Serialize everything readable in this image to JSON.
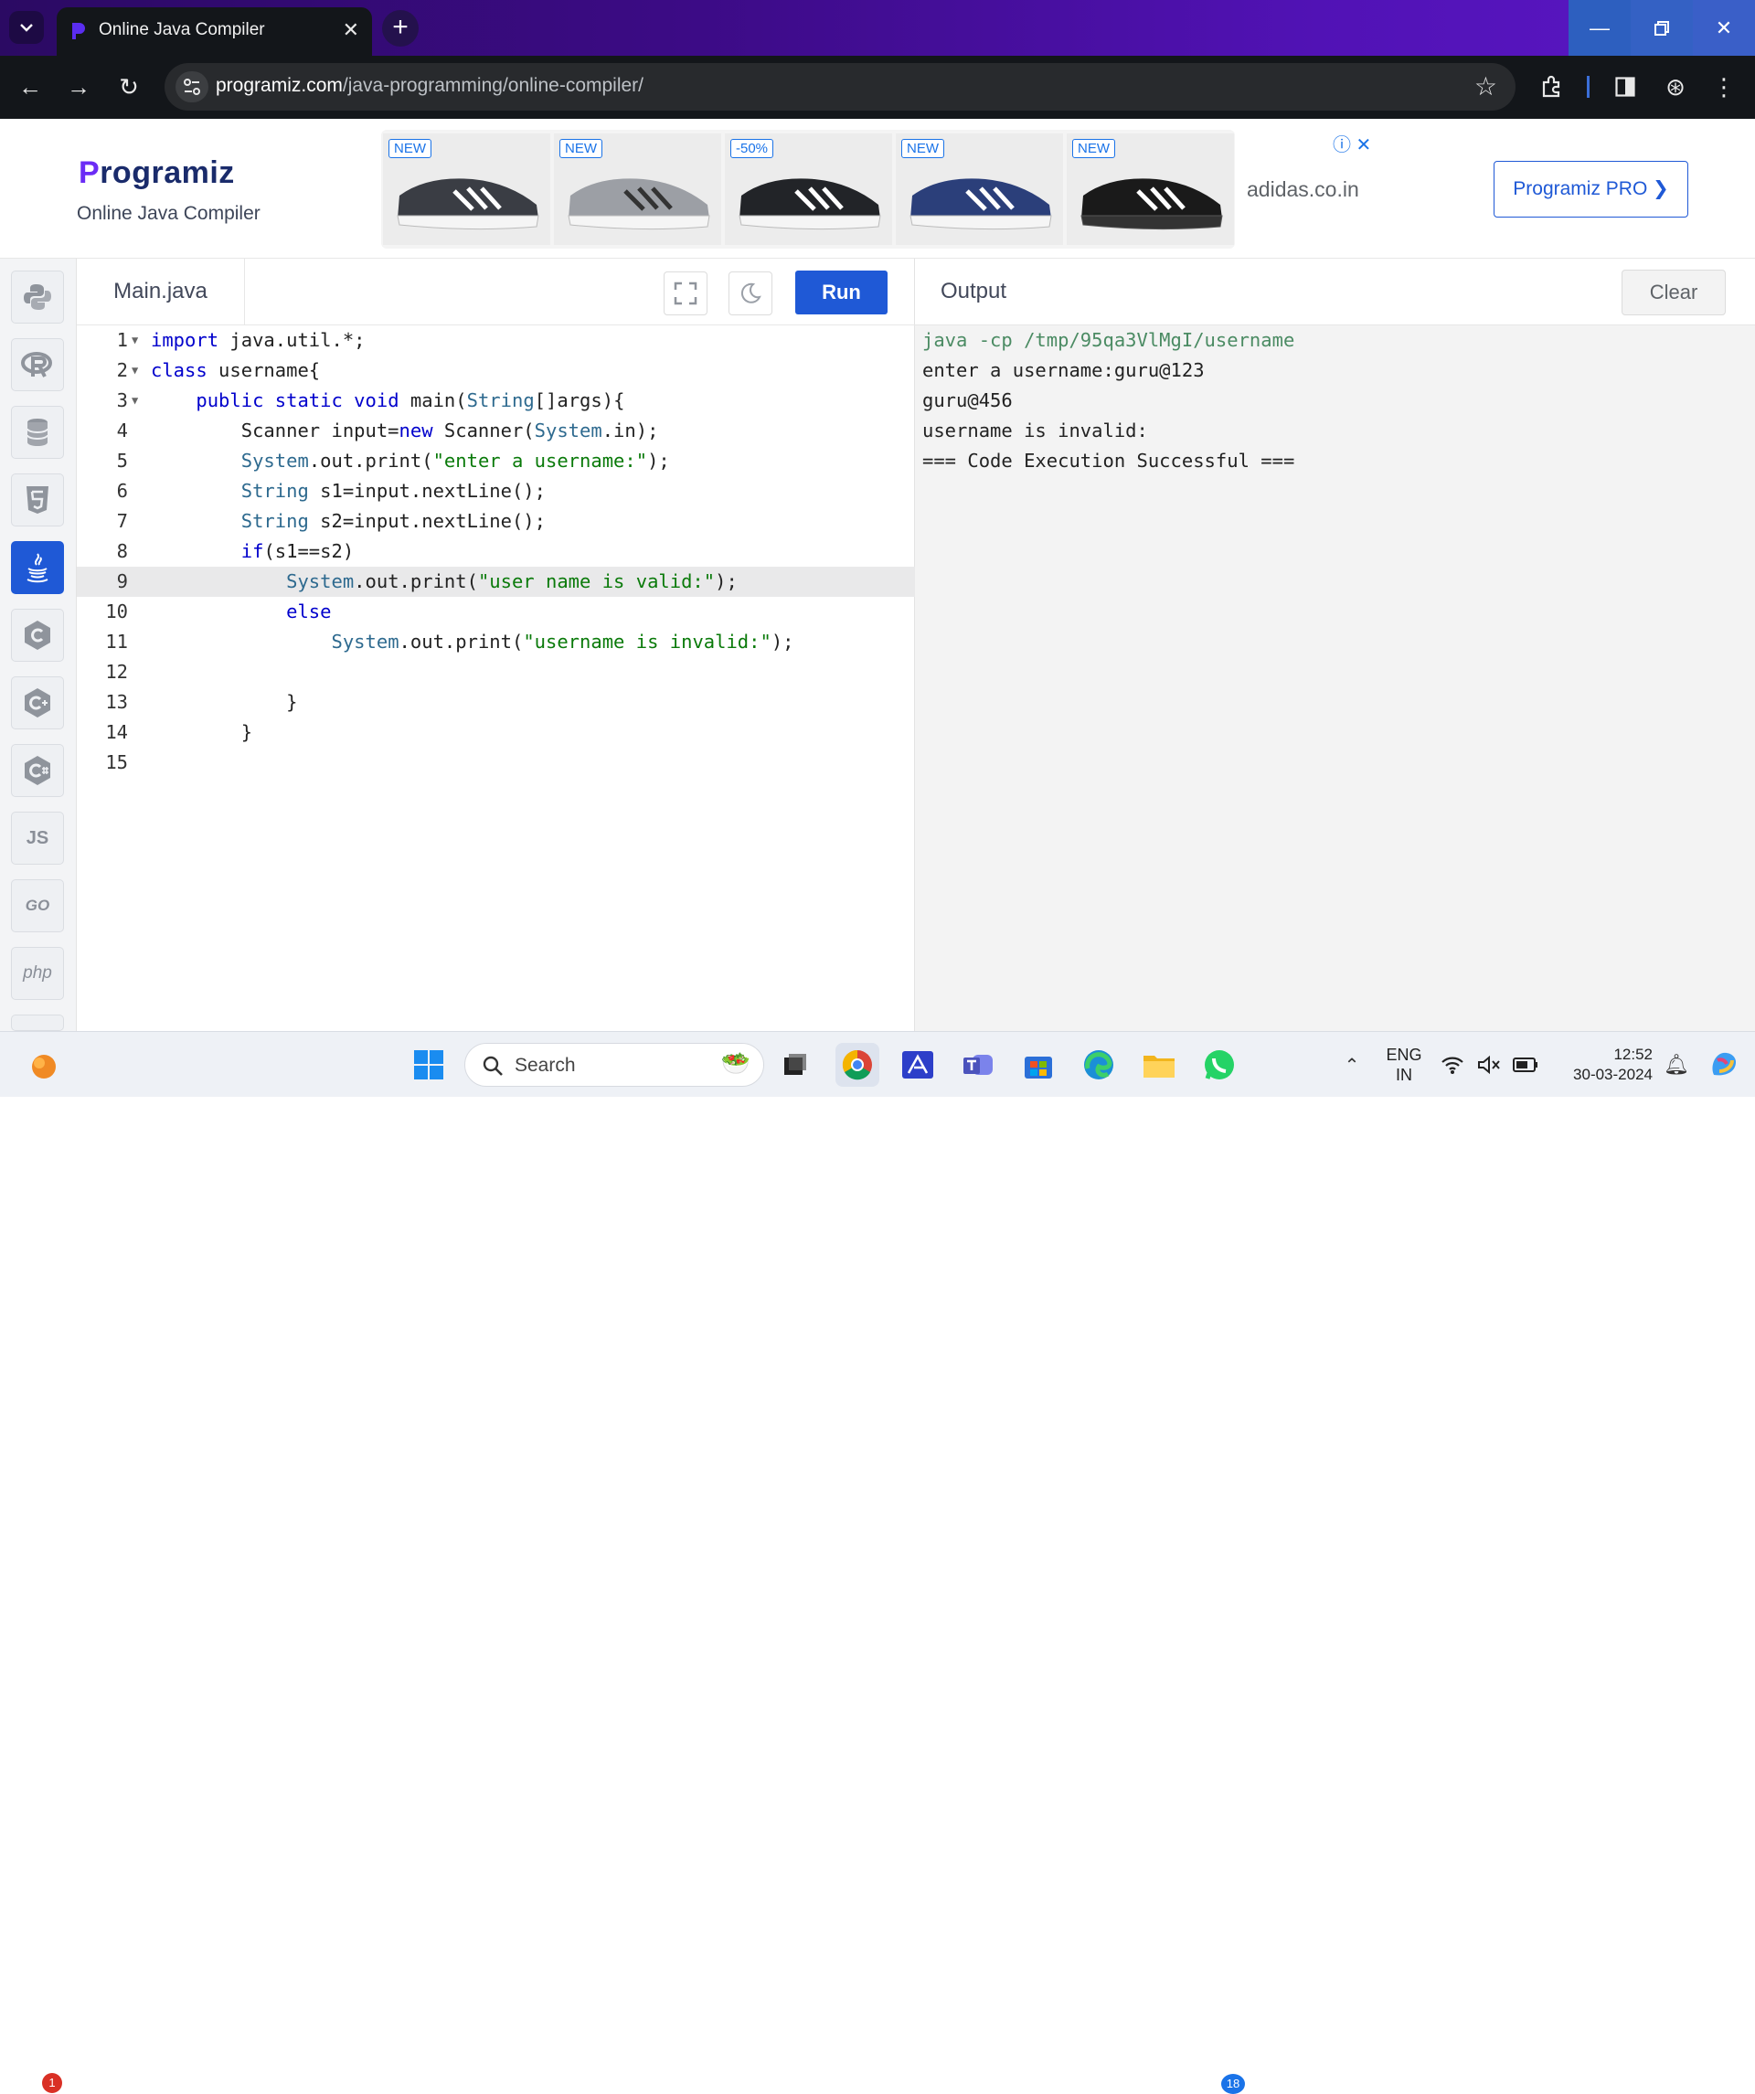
{
  "browser": {
    "tab_title": "Online Java Compiler",
    "url_host": "programiz.com",
    "url_path": "/java-programming/online-compiler/"
  },
  "site": {
    "logo": "rogramiz",
    "logo_letter": "P",
    "page_title": "Online Java Compiler",
    "pro_button": "Programiz PRO ❯"
  },
  "ad": {
    "badges": [
      "NEW",
      "NEW",
      "-50%",
      "NEW",
      "NEW"
    ],
    "shoe_colors": [
      "#3a3d44",
      "#9c9fa5",
      "#222428",
      "#2b3f7a",
      "#1a1a1a"
    ],
    "domain": "adidas.co.in"
  },
  "sidebar": {
    "languages": [
      "python",
      "r",
      "sql",
      "html",
      "java",
      "c",
      "cpp",
      "csharp",
      "js",
      "go",
      "php"
    ],
    "active": "java",
    "text_labels": {
      "js": "JS",
      "go": "GO",
      "php": "php"
    }
  },
  "editor": {
    "file_tab": "Main.java",
    "run_label": "Run",
    "highlighted_line": 9,
    "lines": [
      {
        "n": "1",
        "fold": true
      },
      {
        "n": "2",
        "fold": true
      },
      {
        "n": "3",
        "fold": true
      },
      {
        "n": "4"
      },
      {
        "n": "5"
      },
      {
        "n": "6"
      },
      {
        "n": "7"
      },
      {
        "n": "8"
      },
      {
        "n": "9"
      },
      {
        "n": "10"
      },
      {
        "n": "11"
      },
      {
        "n": "12"
      },
      {
        "n": "13"
      },
      {
        "n": "14"
      },
      {
        "n": "15"
      }
    ]
  },
  "output": {
    "title": "Output",
    "clear_label": "Clear",
    "lines": [
      "java -cp /tmp/95qa3VlMgI/username",
      "enter a username:guru@123",
      "guru@456",
      "username is invalid:",
      "=== Code Execution Successful ==="
    ]
  },
  "taskbar": {
    "search_placeholder": "Search",
    "notification_count": "1",
    "whatsapp_count": "18",
    "lang_line1": "ENG",
    "lang_line2": "IN",
    "time": "12:52",
    "date": "30-03-2024"
  }
}
